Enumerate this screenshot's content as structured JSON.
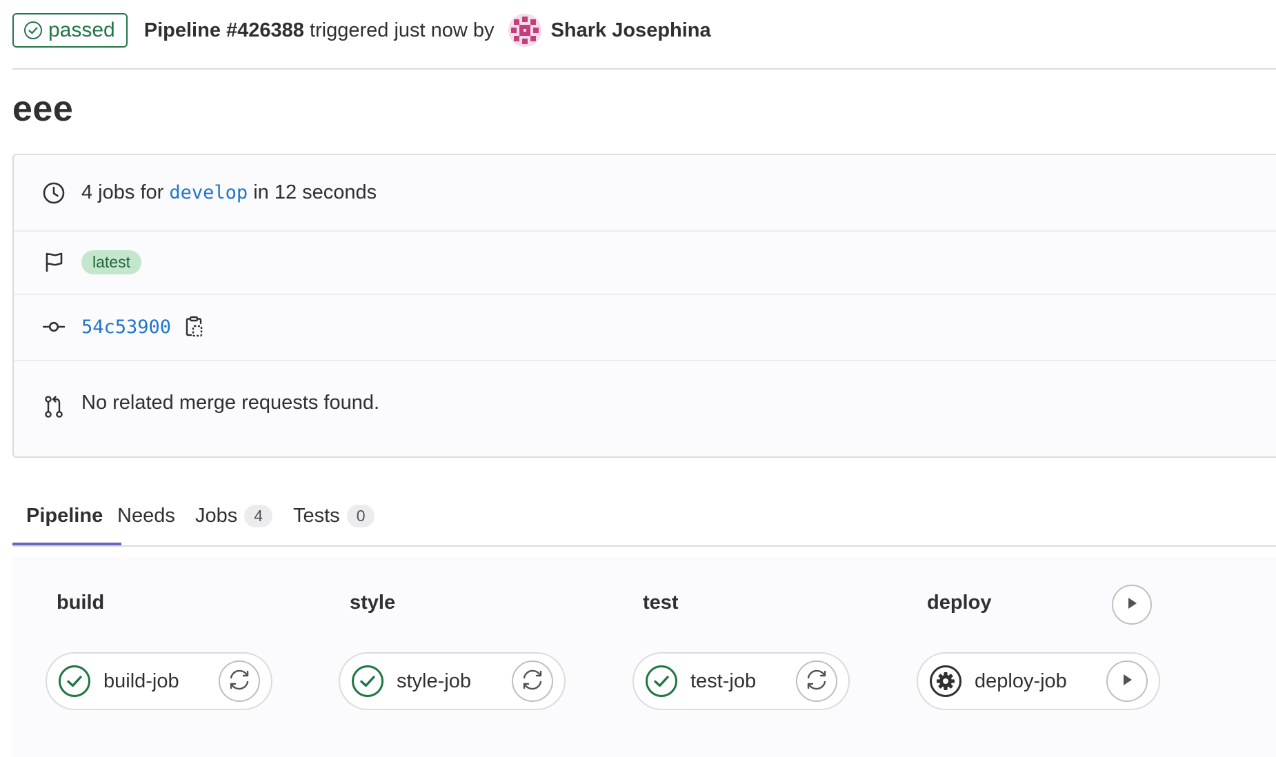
{
  "header": {
    "status_label": "passed",
    "pipeline_label": "Pipeline #426388",
    "triggered_text": " triggered just now by",
    "author_name": "Shark Josephina"
  },
  "title": "eee",
  "info": {
    "jobs_prefix": "4 jobs for ",
    "branch": "develop",
    "duration_text": " in 12 seconds",
    "badge": "latest",
    "commit_sha": "54c53900",
    "merge_requests_text": "No related merge requests found."
  },
  "tabs": [
    {
      "label": "Pipeline",
      "count": null,
      "active": true
    },
    {
      "label": "Needs",
      "count": null,
      "active": false
    },
    {
      "label": "Jobs",
      "count": "4",
      "active": false
    },
    {
      "label": "Tests",
      "count": "0",
      "active": false
    }
  ],
  "stages": [
    {
      "name": "build",
      "job": {
        "name": "build-job",
        "status": "success",
        "action": "retry"
      }
    },
    {
      "name": "style",
      "job": {
        "name": "style-job",
        "status": "success",
        "action": "retry"
      }
    },
    {
      "name": "test",
      "job": {
        "name": "test-job",
        "status": "success",
        "action": "retry"
      }
    },
    {
      "name": "deploy",
      "job": {
        "name": "deploy-job",
        "status": "manual",
        "action": "play"
      },
      "stage_action": "play"
    }
  ],
  "icons": {
    "status": "check-circle-icon",
    "clock": "clock-icon",
    "flag": "flag-icon",
    "commit": "commit-icon",
    "merge_request": "merge-request-icon",
    "copy": "copy-to-clipboard-icon",
    "retry": "retry-icon",
    "play": "play-icon",
    "manual": "gear-icon"
  },
  "colors": {
    "success": "#217645",
    "link": "#1f75cb",
    "tab_underline": "#6666c4",
    "badge_bg": "#c3e6cd",
    "badge_fg": "#24663b",
    "avatar": "#c0407e"
  }
}
